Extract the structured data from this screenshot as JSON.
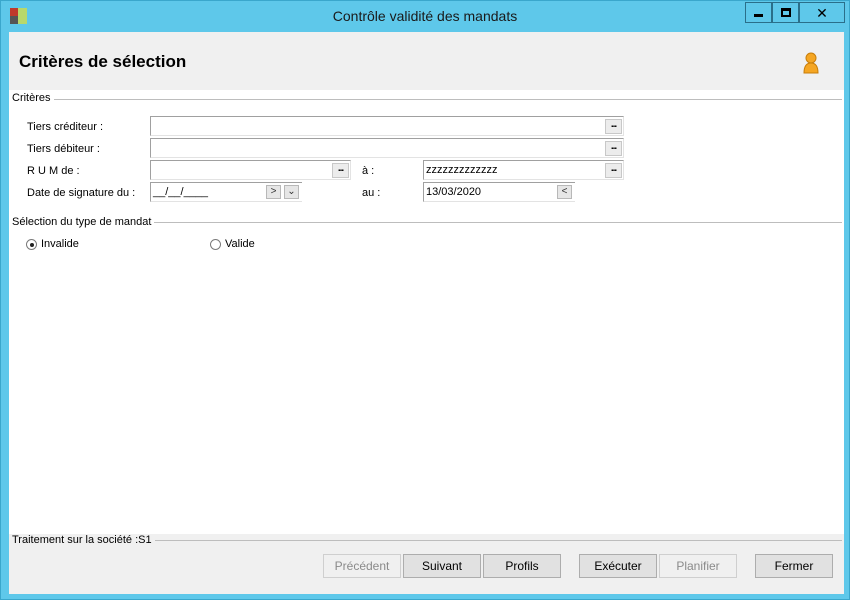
{
  "window": {
    "title": "Contrôle validité des mandats",
    "close_glyph": "✕"
  },
  "header": {
    "title": "Critères de sélection"
  },
  "criteria": {
    "group_title": "Critères",
    "tiers_crediteur_label": "Tiers créditeur :",
    "tiers_crediteur_value": "",
    "tiers_debiteur_label": "Tiers débiteur :",
    "tiers_debiteur_value": "",
    "rum_from_label": "R U M de  :",
    "rum_from_value": "",
    "rum_to_label": "à :",
    "rum_to_value": "zzzzzzzzzzzzz",
    "date_from_label": "Date de signature du :",
    "date_from_value": "__/__/____",
    "date_to_label": "au :",
    "date_to_value": "13/03/2020",
    "browse_glyph": "...",
    "next_glyph": ">",
    "dropdown_glyph": "⌄",
    "prev_glyph": "<"
  },
  "mandate_type": {
    "group_title": "Sélection du type de mandat",
    "options": [
      {
        "label": "Invalide",
        "selected": true
      },
      {
        "label": "Valide",
        "selected": false
      }
    ]
  },
  "footer": {
    "group_title": "Traitement sur la société :S1",
    "buttons": {
      "previous": "Précédent",
      "next": "Suivant",
      "profiles": "Profils",
      "execute": "Exécuter",
      "schedule": "Planifier",
      "close": "Fermer"
    }
  },
  "colors": {
    "title_bar": "#5ec8ea",
    "user_icon": "#f5a623"
  }
}
